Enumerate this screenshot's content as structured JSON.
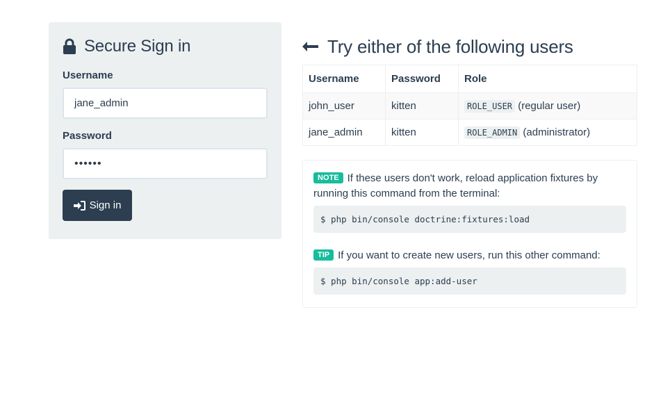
{
  "login": {
    "title": "Secure Sign in",
    "username_label": "Username",
    "username_value": "jane_admin",
    "password_label": "Password",
    "password_display": "••••••",
    "signin_label": "Sign in"
  },
  "users": {
    "title": "Try either of the following users",
    "columns": [
      "Username",
      "Password",
      "Role"
    ],
    "rows": [
      {
        "username": "john_user",
        "password": "kitten",
        "role_code": "ROLE_USER",
        "role_desc": "(regular user)"
      },
      {
        "username": "jane_admin",
        "password": "kitten",
        "role_code": "ROLE_ADMIN",
        "role_desc": "(administrator)"
      }
    ]
  },
  "note": {
    "badge": "NOTE",
    "text": "If these users don't work, reload application fixtures by running this command from the terminal:",
    "command": "$ php bin/console doctrine:fixtures:load"
  },
  "tip": {
    "badge": "TIP",
    "text": "If you want to create new users, run this other command:",
    "command": "$ php bin/console app:add-user"
  },
  "icons": {
    "lock": "lock-icon",
    "signin": "sign-in-icon",
    "arrow": "arrow-left-icon"
  },
  "colors": {
    "primary": "#2c3e50",
    "panel_bg": "#ecf0f1",
    "badge_bg": "#18bc9c"
  }
}
